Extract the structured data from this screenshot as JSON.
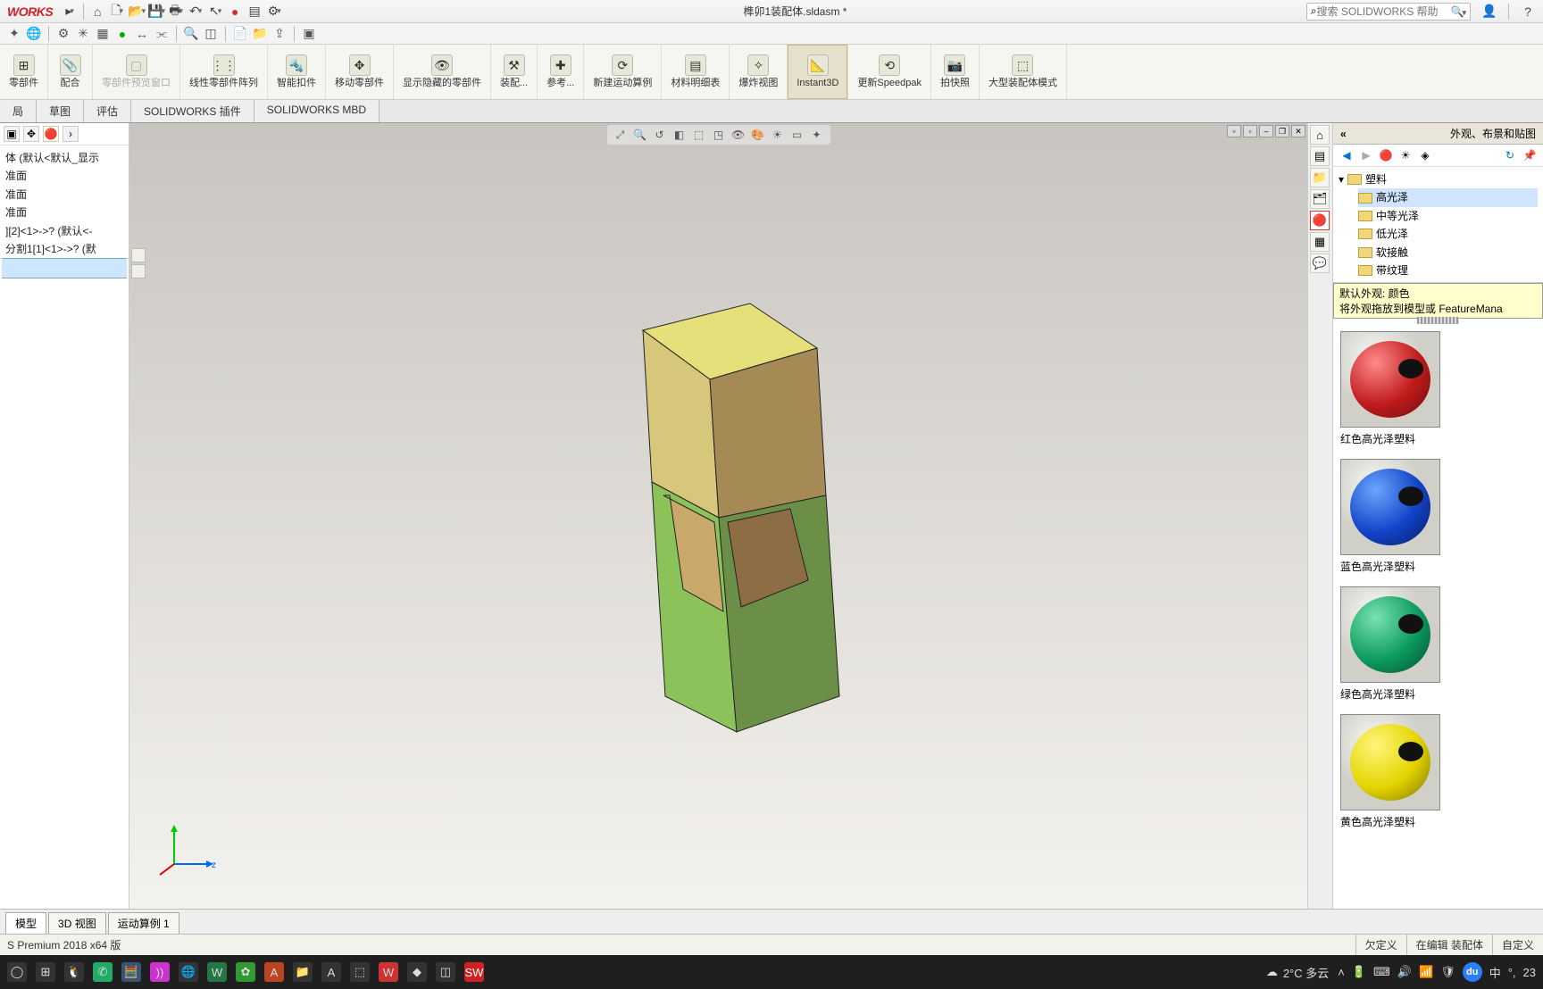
{
  "title_bar": {
    "logo": "WORKS",
    "doc_title": "榫卯1装配体.sldasm *",
    "search_placeholder": "搜索 SOLIDWORKS 帮助"
  },
  "ribbon": {
    "items": [
      {
        "label": "零部件",
        "sub": ""
      },
      {
        "label": "配合",
        "sub": ""
      },
      {
        "label": "零部件预览窗口",
        "sub": "",
        "disabled": true
      },
      {
        "label": "线性零部件阵列",
        "sub": ""
      },
      {
        "label": "智能扣件",
        "sub": ""
      },
      {
        "label": "移动零部件",
        "sub": ""
      },
      {
        "label": "显示隐藏的零部件",
        "sub": ""
      },
      {
        "label": "装配...",
        "sub": ""
      },
      {
        "label": "参考...",
        "sub": ""
      },
      {
        "label": "新建运动算例",
        "sub": ""
      },
      {
        "label": "材料明细表",
        "sub": ""
      },
      {
        "label": "爆炸视图",
        "sub": ""
      },
      {
        "label": "Instant3D",
        "sub": "",
        "active": true
      },
      {
        "label": "更新Speedpak",
        "sub": ""
      },
      {
        "label": "拍快照",
        "sub": ""
      },
      {
        "label": "大型装配体模式",
        "sub": ""
      }
    ]
  },
  "tabs": [
    "局",
    "草图",
    "评估",
    "SOLIDWORKS 插件",
    "SOLIDWORKS MBD"
  ],
  "fm_tree": [
    "体 (默认<默认_显示",
    "",
    "准面",
    "准面",
    "准面",
    "",
    "][2]<1>->? (默认<-",
    "分割1[1]<1>->? (默"
  ],
  "right_panel": {
    "title": "外观、布景和贴图",
    "tree_root": "塑料",
    "tree_children": [
      "高光泽",
      "中等光泽",
      "低光泽",
      "软接触",
      "带纹理"
    ],
    "tooltip_title": "默认外观: 颜色",
    "tooltip_body": "将外观拖放到模型或 FeatureMana",
    "swatches": [
      {
        "key": "red",
        "label": "红色高光泽塑料"
      },
      {
        "key": "blue",
        "label": "蓝色高光泽塑料"
      },
      {
        "key": "green",
        "label": "绿色高光泽塑料"
      },
      {
        "key": "yellow",
        "label": "黄色高光泽塑料"
      }
    ]
  },
  "bottom_tabs": [
    "模型",
    "3D 视图",
    "运动算例 1"
  ],
  "status": {
    "version": "S Premium 2018 x64 版",
    "cells": [
      "欠定义",
      "在编辑 装配体",
      "自定义"
    ]
  },
  "taskbar": {
    "weather": "2°C 多云",
    "ime": "中",
    "clock": "23",
    "du": "du"
  }
}
